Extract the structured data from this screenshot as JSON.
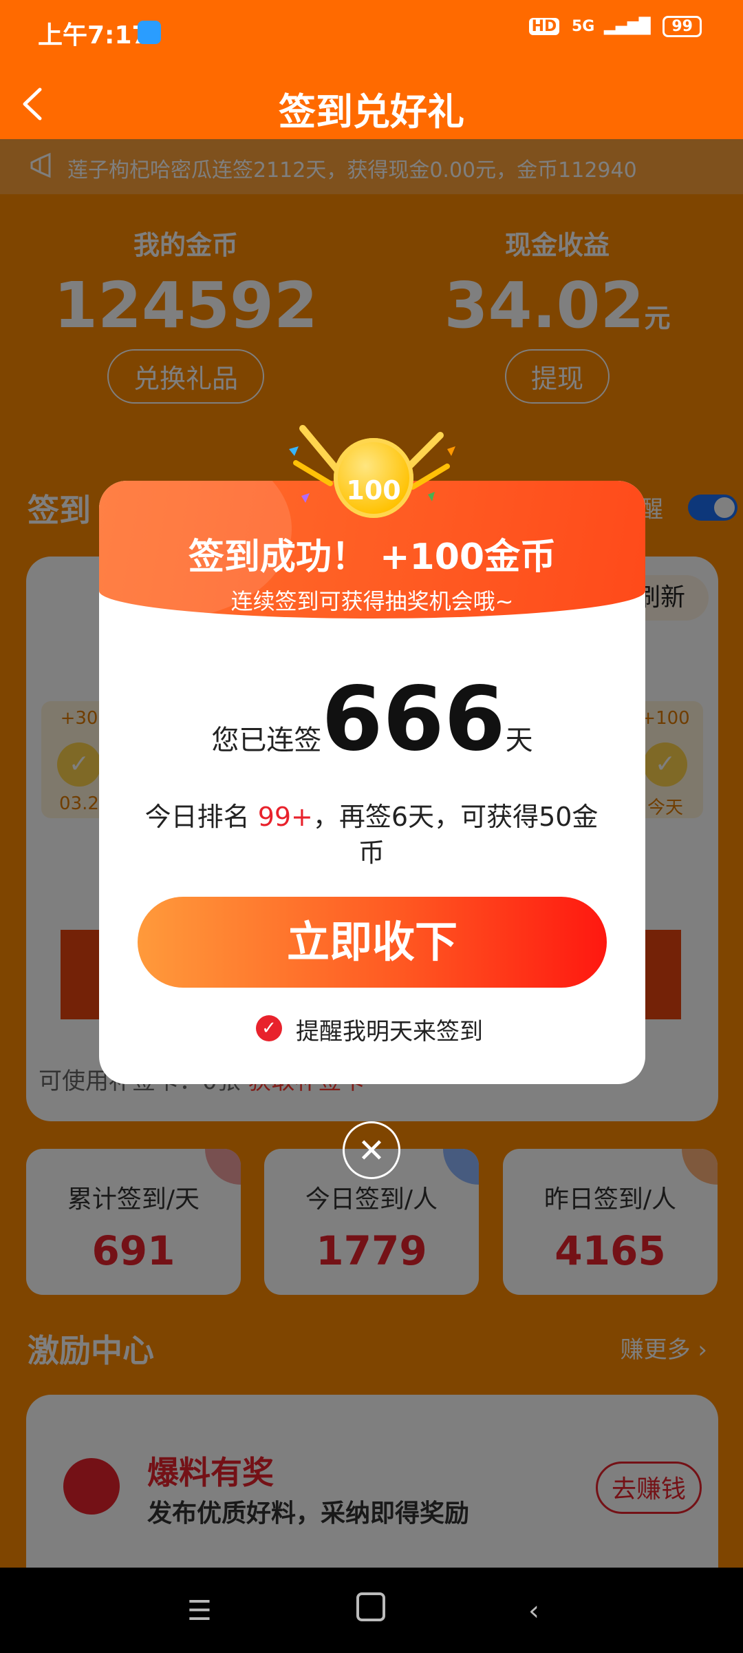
{
  "status": {
    "time": "上午7:17",
    "hd": "HD",
    "network": "5G",
    "battery": "99"
  },
  "header": {
    "title": "签到兑好礼"
  },
  "notice": {
    "text": "莲子枸杞哈密瓜连签2112天，获得现金0.00元，金币112940"
  },
  "stats": {
    "coins_label": "我的金币",
    "coins_value": "124592",
    "coins_btn": "兑换礼品",
    "cash_label": "现金收益",
    "cash_value": "34.02",
    "cash_unit": "元",
    "cash_btn": "提现"
  },
  "sign": {
    "section_title": "签到",
    "remind_label": "醒",
    "refresh_label": "刷新",
    "left_day": {
      "bonus": "+30",
      "date": "03.2"
    },
    "right_day": {
      "bonus": "+100",
      "date": "今天"
    },
    "coupon_text": "可使用补签卡：0张",
    "coupon_link": "获取补签卡"
  },
  "counters": [
    {
      "label": "累计签到/天",
      "value": "691",
      "color": "#f0a0a0"
    },
    {
      "label": "今日签到/人",
      "value": "1779",
      "color": "#8fb6ff"
    },
    {
      "label": "昨日签到/人",
      "value": "4165",
      "color": "#ffb37a"
    }
  ],
  "incentive": {
    "title": "激励中心",
    "more": "赚更多",
    "item_name": "爆料有奖",
    "item_desc": "发布优质好料，采纳即得奖励",
    "item_btn": "去赚钱"
  },
  "modal": {
    "coin_value": "100",
    "title": "签到成功！ +100金币",
    "subtitle": "连续签到可获得抽奖机会哦~",
    "streak_prefix": "您已连签",
    "streak_days": "666",
    "streak_unit": "天",
    "rank_prefix": "今日排名",
    "rank_value": "99+",
    "rank_suffix": "，再签6天，可获得50金币",
    "accept_btn": "立即收下",
    "remind_text": "提醒我明天来签到"
  }
}
